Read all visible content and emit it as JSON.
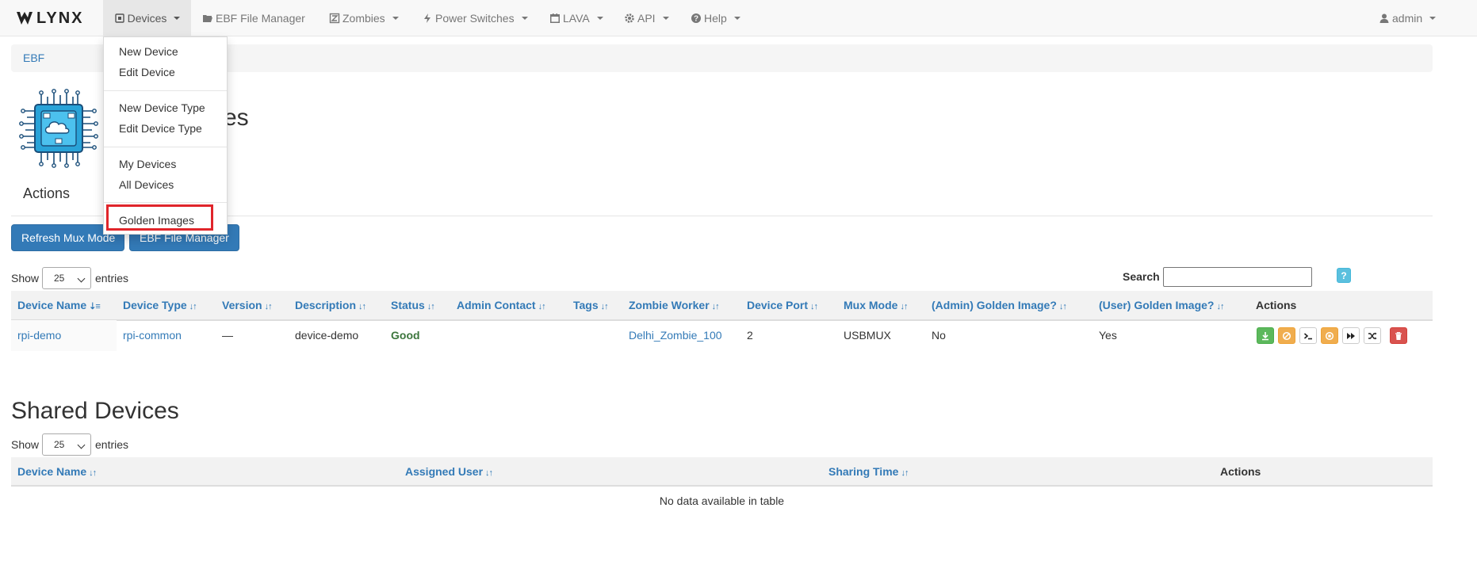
{
  "navbar": {
    "brand": "LYNX",
    "items": [
      {
        "label": "Devices",
        "icon": "device-icon"
      },
      {
        "label": "EBF File Manager",
        "icon": "folder-open-icon"
      },
      {
        "label": "Zombies",
        "icon": "zombie-icon"
      },
      {
        "label": "Power Switches",
        "icon": "bolt-icon"
      },
      {
        "label": "LAVA",
        "icon": "calendar-icon"
      },
      {
        "label": "API",
        "icon": "gear-icon"
      },
      {
        "label": "Help",
        "icon": "question-circle-icon"
      }
    ],
    "user": {
      "label": "admin",
      "icon": "user-icon"
    }
  },
  "dropdown": {
    "groups": [
      [
        "New Device",
        "Edit Device"
      ],
      [
        "New Device Type",
        "Edit Device Type"
      ],
      [
        "My Devices",
        "All Devices"
      ],
      [
        "Golden Images"
      ]
    ],
    "highlighted": "Golden Images"
  },
  "breadcrumb": "EBF",
  "page": {
    "title_suffix": "es",
    "actions_heading": "Actions",
    "buttons": [
      "Refresh Mux Mode",
      "EBF File Manager"
    ]
  },
  "devices_table": {
    "length_prefix": "Show",
    "length_value": "25",
    "length_suffix": "entries",
    "search_label": "Search",
    "search_value": "",
    "help_label": "?",
    "columns": [
      "Device Name",
      "Device Type",
      "Version",
      "Description",
      "Status",
      "Admin Contact",
      "Tags",
      "Zombie Worker",
      "Device Port",
      "Mux Mode",
      "(Admin) Golden Image?",
      "(User) Golden Image?",
      "Actions"
    ],
    "rows": [
      {
        "device_name": "rpi-demo",
        "device_type": "rpi-common",
        "version": "—",
        "description": "device-demo",
        "status": "Good",
        "admin_contact": "",
        "tags": "",
        "zombie_worker": "Delhi_Zombie_100",
        "device_port": "2",
        "mux_mode": "USBMUX",
        "admin_golden": "No",
        "user_golden": "Yes"
      }
    ],
    "action_icons": [
      {
        "name": "flash-icon",
        "color": "#5cb85c"
      },
      {
        "name": "ban-icon",
        "color": "#f0ad4e"
      },
      {
        "name": "terminal-icon",
        "color": "#ffffff"
      },
      {
        "name": "stop-circle-icon",
        "color": "#f0ad4e"
      },
      {
        "name": "fast-forward-icon",
        "color": "#ffffff"
      },
      {
        "name": "shuffle-icon",
        "color": "#ffffff"
      },
      {
        "name": "trash-icon",
        "color": "#d9534f"
      }
    ]
  },
  "shared_devices": {
    "title": "Shared Devices",
    "length_prefix": "Show",
    "length_value": "25",
    "length_suffix": "entries",
    "columns": [
      "Device Name",
      "Assigned User",
      "Sharing Time",
      "Actions"
    ],
    "empty_message": "No data available in table"
  },
  "colors": {
    "link": "#337ab7",
    "primary_button": "#337ab7",
    "status_good": "#3c763d",
    "highlight_box": "#e0252b"
  }
}
